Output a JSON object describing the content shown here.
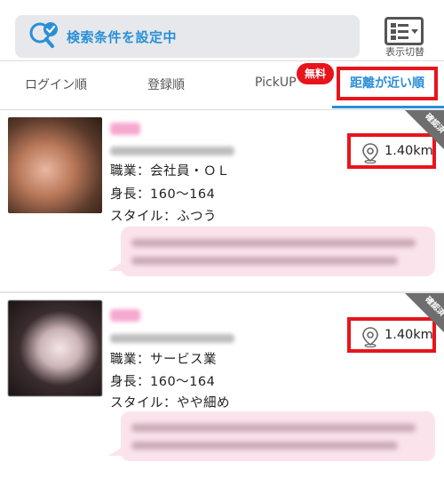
{
  "header": {
    "search_label": "検索条件を設定中",
    "toggle_label": "表示切替"
  },
  "tabs": [
    {
      "label": "ログイン順",
      "active": false
    },
    {
      "label": "登録順",
      "active": false
    },
    {
      "label": "PickUP",
      "active": false,
      "badge": "無料"
    },
    {
      "label": "距離が近い順",
      "active": true
    }
  ],
  "profiles": [
    {
      "occupation": "職業：会社員・ＯＬ",
      "height": "身長：160～164",
      "style": "スタイル：ふつう",
      "distance": "1.40km",
      "verified_badge": "確認済"
    },
    {
      "occupation": "職業：サービス業",
      "height": "身長：160～164",
      "style": "スタイル：やや細め",
      "distance": "1.40km",
      "verified_badge": "確認済"
    }
  ],
  "colors": {
    "accent_blue": "#2a8fd8",
    "highlight_red": "#e8141c",
    "bubble_pink": "#fbe3ec"
  }
}
